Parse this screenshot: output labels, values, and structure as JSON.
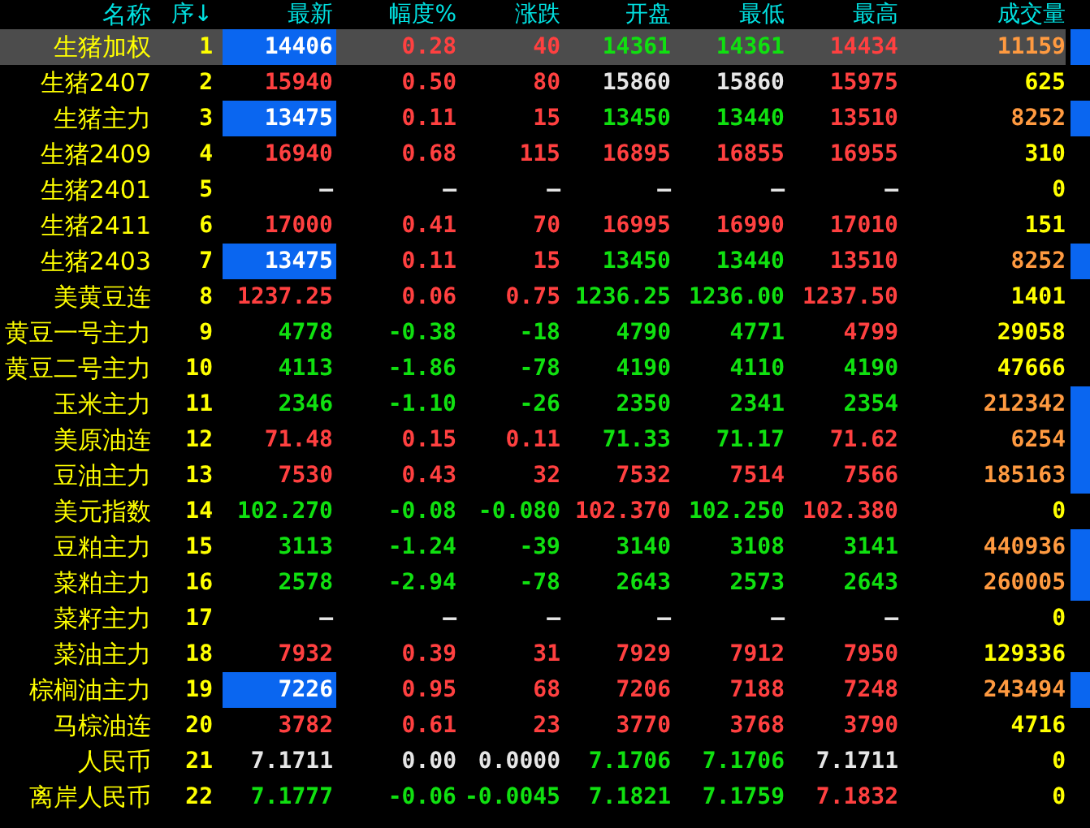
{
  "table": {
    "columns": [
      "名称",
      "序↓",
      "最新",
      "幅度%",
      "涨跌",
      "开盘",
      "最低",
      "最高",
      "成交量"
    ],
    "rows": [
      {
        "selected": true,
        "highlighted": true,
        "flagged": true,
        "cells": [
          {
            "text": "生猪加权",
            "color": "#ffff00"
          },
          {
            "text": "1",
            "color": "#ffff00"
          },
          {
            "text": "14406",
            "color": "#ffffff"
          },
          {
            "text": "0.28",
            "color": "#ff4040"
          },
          {
            "text": "40",
            "color": "#ff4040"
          },
          {
            "text": "14361",
            "color": "#10e010"
          },
          {
            "text": "14361",
            "color": "#10e010"
          },
          {
            "text": "14434",
            "color": "#ff4040"
          },
          {
            "text": "11159",
            "color": "#ff9a40"
          }
        ]
      },
      {
        "selected": false,
        "highlighted": false,
        "flagged": false,
        "cells": [
          {
            "text": "生猪2407",
            "color": "#ffff00"
          },
          {
            "text": "2",
            "color": "#ffff00"
          },
          {
            "text": "15940",
            "color": "#ff4040"
          },
          {
            "text": "0.50",
            "color": "#ff4040"
          },
          {
            "text": "80",
            "color": "#ff4040"
          },
          {
            "text": "15860",
            "color": "#e6e6e6"
          },
          {
            "text": "15860",
            "color": "#e6e6e6"
          },
          {
            "text": "15975",
            "color": "#ff4040"
          },
          {
            "text": "625",
            "color": "#ffff00"
          }
        ]
      },
      {
        "selected": false,
        "highlighted": true,
        "flagged": true,
        "cells": [
          {
            "text": "生猪主力",
            "color": "#ffff00"
          },
          {
            "text": "3",
            "color": "#ffff00"
          },
          {
            "text": "13475",
            "color": "#ffffff"
          },
          {
            "text": "0.11",
            "color": "#ff4040"
          },
          {
            "text": "15",
            "color": "#ff4040"
          },
          {
            "text": "13450",
            "color": "#10e010"
          },
          {
            "text": "13440",
            "color": "#10e010"
          },
          {
            "text": "13510",
            "color": "#ff4040"
          },
          {
            "text": "8252",
            "color": "#ff9a40"
          }
        ]
      },
      {
        "selected": false,
        "highlighted": false,
        "flagged": false,
        "cells": [
          {
            "text": "生猪2409",
            "color": "#ffff00"
          },
          {
            "text": "4",
            "color": "#ffff00"
          },
          {
            "text": "16940",
            "color": "#ff4040"
          },
          {
            "text": "0.68",
            "color": "#ff4040"
          },
          {
            "text": "115",
            "color": "#ff4040"
          },
          {
            "text": "16895",
            "color": "#ff4040"
          },
          {
            "text": "16855",
            "color": "#ff4040"
          },
          {
            "text": "16955",
            "color": "#ff4040"
          },
          {
            "text": "310",
            "color": "#ffff00"
          }
        ]
      },
      {
        "selected": false,
        "highlighted": false,
        "flagged": false,
        "cells": [
          {
            "text": "生猪2401",
            "color": "#ffff00"
          },
          {
            "text": "5",
            "color": "#ffff00"
          },
          {
            "text": "—",
            "color": "#e6e6e6"
          },
          {
            "text": "—",
            "color": "#e6e6e6"
          },
          {
            "text": "—",
            "color": "#e6e6e6"
          },
          {
            "text": "—",
            "color": "#e6e6e6"
          },
          {
            "text": "—",
            "color": "#e6e6e6"
          },
          {
            "text": "—",
            "color": "#e6e6e6"
          },
          {
            "text": "0",
            "color": "#ffff00"
          }
        ]
      },
      {
        "selected": false,
        "highlighted": false,
        "flagged": false,
        "cells": [
          {
            "text": "生猪2411",
            "color": "#ffff00"
          },
          {
            "text": "6",
            "color": "#ffff00"
          },
          {
            "text": "17000",
            "color": "#ff4040"
          },
          {
            "text": "0.41",
            "color": "#ff4040"
          },
          {
            "text": "70",
            "color": "#ff4040"
          },
          {
            "text": "16995",
            "color": "#ff4040"
          },
          {
            "text": "16990",
            "color": "#ff4040"
          },
          {
            "text": "17010",
            "color": "#ff4040"
          },
          {
            "text": "151",
            "color": "#ffff00"
          }
        ]
      },
      {
        "selected": false,
        "highlighted": true,
        "flagged": true,
        "cells": [
          {
            "text": "生猪2403",
            "color": "#ffff00"
          },
          {
            "text": "7",
            "color": "#ffff00"
          },
          {
            "text": "13475",
            "color": "#ffffff"
          },
          {
            "text": "0.11",
            "color": "#ff4040"
          },
          {
            "text": "15",
            "color": "#ff4040"
          },
          {
            "text": "13450",
            "color": "#10e010"
          },
          {
            "text": "13440",
            "color": "#10e010"
          },
          {
            "text": "13510",
            "color": "#ff4040"
          },
          {
            "text": "8252",
            "color": "#ff9a40"
          }
        ]
      },
      {
        "selected": false,
        "highlighted": false,
        "flagged": false,
        "cells": [
          {
            "text": "美黄豆连",
            "color": "#ffff00"
          },
          {
            "text": "8",
            "color": "#ffff00"
          },
          {
            "text": "1237.25",
            "color": "#ff4040"
          },
          {
            "text": "0.06",
            "color": "#ff4040"
          },
          {
            "text": "0.75",
            "color": "#ff4040"
          },
          {
            "text": "1236.25",
            "color": "#10e010"
          },
          {
            "text": "1236.00",
            "color": "#10e010"
          },
          {
            "text": "1237.50",
            "color": "#ff4040"
          },
          {
            "text": "1401",
            "color": "#ffff00"
          }
        ]
      },
      {
        "selected": false,
        "highlighted": false,
        "flagged": false,
        "cells": [
          {
            "text": "黄豆一号主力",
            "color": "#ffff00"
          },
          {
            "text": "9",
            "color": "#ffff00"
          },
          {
            "text": "4778",
            "color": "#10e010"
          },
          {
            "text": "-0.38",
            "color": "#10e010"
          },
          {
            "text": "-18",
            "color": "#10e010"
          },
          {
            "text": "4790",
            "color": "#10e010"
          },
          {
            "text": "4771",
            "color": "#10e010"
          },
          {
            "text": "4799",
            "color": "#ff4040"
          },
          {
            "text": "29058",
            "color": "#ffff00"
          }
        ]
      },
      {
        "selected": false,
        "highlighted": false,
        "flagged": false,
        "cells": [
          {
            "text": "黄豆二号主力",
            "color": "#ffff00"
          },
          {
            "text": "10",
            "color": "#ffff00"
          },
          {
            "text": "4113",
            "color": "#10e010"
          },
          {
            "text": "-1.86",
            "color": "#10e010"
          },
          {
            "text": "-78",
            "color": "#10e010"
          },
          {
            "text": "4190",
            "color": "#10e010"
          },
          {
            "text": "4110",
            "color": "#10e010"
          },
          {
            "text": "4190",
            "color": "#10e010"
          },
          {
            "text": "47666",
            "color": "#ffff00"
          }
        ]
      },
      {
        "selected": false,
        "highlighted": false,
        "flagged": true,
        "cells": [
          {
            "text": "玉米主力",
            "color": "#ffff00"
          },
          {
            "text": "11",
            "color": "#ffff00"
          },
          {
            "text": "2346",
            "color": "#10e010"
          },
          {
            "text": "-1.10",
            "color": "#10e010"
          },
          {
            "text": "-26",
            "color": "#10e010"
          },
          {
            "text": "2350",
            "color": "#10e010"
          },
          {
            "text": "2341",
            "color": "#10e010"
          },
          {
            "text": "2354",
            "color": "#10e010"
          },
          {
            "text": "212342",
            "color": "#ff9a40"
          }
        ]
      },
      {
        "selected": false,
        "highlighted": false,
        "flagged": true,
        "cells": [
          {
            "text": "美原油连",
            "color": "#ffff00"
          },
          {
            "text": "12",
            "color": "#ffff00"
          },
          {
            "text": "71.48",
            "color": "#ff4040"
          },
          {
            "text": "0.15",
            "color": "#ff4040"
          },
          {
            "text": "0.11",
            "color": "#ff4040"
          },
          {
            "text": "71.33",
            "color": "#10e010"
          },
          {
            "text": "71.17",
            "color": "#10e010"
          },
          {
            "text": "71.62",
            "color": "#ff4040"
          },
          {
            "text": "6254",
            "color": "#ff9a40"
          }
        ]
      },
      {
        "selected": false,
        "highlighted": false,
        "flagged": true,
        "cells": [
          {
            "text": "豆油主力",
            "color": "#ffff00"
          },
          {
            "text": "13",
            "color": "#ffff00"
          },
          {
            "text": "7530",
            "color": "#ff4040"
          },
          {
            "text": "0.43",
            "color": "#ff4040"
          },
          {
            "text": "32",
            "color": "#ff4040"
          },
          {
            "text": "7532",
            "color": "#ff4040"
          },
          {
            "text": "7514",
            "color": "#ff4040"
          },
          {
            "text": "7566",
            "color": "#ff4040"
          },
          {
            "text": "185163",
            "color": "#ff9a40"
          }
        ]
      },
      {
        "selected": false,
        "highlighted": false,
        "flagged": false,
        "cells": [
          {
            "text": "美元指数",
            "color": "#ffff00"
          },
          {
            "text": "14",
            "color": "#ffff00"
          },
          {
            "text": "102.270",
            "color": "#10e010"
          },
          {
            "text": "-0.08",
            "color": "#10e010"
          },
          {
            "text": "-0.080",
            "color": "#10e010"
          },
          {
            "text": "102.370",
            "color": "#ff4040"
          },
          {
            "text": "102.250",
            "color": "#10e010"
          },
          {
            "text": "102.380",
            "color": "#ff4040"
          },
          {
            "text": "0",
            "color": "#ffff00"
          }
        ]
      },
      {
        "selected": false,
        "highlighted": false,
        "flagged": true,
        "cells": [
          {
            "text": "豆粕主力",
            "color": "#ffff00"
          },
          {
            "text": "15",
            "color": "#ffff00"
          },
          {
            "text": "3113",
            "color": "#10e010"
          },
          {
            "text": "-1.24",
            "color": "#10e010"
          },
          {
            "text": "-39",
            "color": "#10e010"
          },
          {
            "text": "3140",
            "color": "#10e010"
          },
          {
            "text": "3108",
            "color": "#10e010"
          },
          {
            "text": "3141",
            "color": "#10e010"
          },
          {
            "text": "440936",
            "color": "#ff9a40"
          }
        ]
      },
      {
        "selected": false,
        "highlighted": false,
        "flagged": true,
        "cells": [
          {
            "text": "菜粕主力",
            "color": "#ffff00"
          },
          {
            "text": "16",
            "color": "#ffff00"
          },
          {
            "text": "2578",
            "color": "#10e010"
          },
          {
            "text": "-2.94",
            "color": "#10e010"
          },
          {
            "text": "-78",
            "color": "#10e010"
          },
          {
            "text": "2643",
            "color": "#10e010"
          },
          {
            "text": "2573",
            "color": "#10e010"
          },
          {
            "text": "2643",
            "color": "#10e010"
          },
          {
            "text": "260005",
            "color": "#ff9a40"
          }
        ]
      },
      {
        "selected": false,
        "highlighted": false,
        "flagged": false,
        "cells": [
          {
            "text": "菜籽主力",
            "color": "#ffff00"
          },
          {
            "text": "17",
            "color": "#ffff00"
          },
          {
            "text": "—",
            "color": "#e6e6e6"
          },
          {
            "text": "—",
            "color": "#e6e6e6"
          },
          {
            "text": "—",
            "color": "#e6e6e6"
          },
          {
            "text": "—",
            "color": "#e6e6e6"
          },
          {
            "text": "—",
            "color": "#e6e6e6"
          },
          {
            "text": "—",
            "color": "#e6e6e6"
          },
          {
            "text": "0",
            "color": "#ffff00"
          }
        ]
      },
      {
        "selected": false,
        "highlighted": false,
        "flagged": false,
        "cells": [
          {
            "text": "菜油主力",
            "color": "#ffff00"
          },
          {
            "text": "18",
            "color": "#ffff00"
          },
          {
            "text": "7932",
            "color": "#ff4040"
          },
          {
            "text": "0.39",
            "color": "#ff4040"
          },
          {
            "text": "31",
            "color": "#ff4040"
          },
          {
            "text": "7929",
            "color": "#ff4040"
          },
          {
            "text": "7912",
            "color": "#ff4040"
          },
          {
            "text": "7950",
            "color": "#ff4040"
          },
          {
            "text": "129336",
            "color": "#ffff00"
          }
        ]
      },
      {
        "selected": false,
        "highlighted": true,
        "flagged": true,
        "cells": [
          {
            "text": "棕榈油主力",
            "color": "#ffff00"
          },
          {
            "text": "19",
            "color": "#ffff00"
          },
          {
            "text": "7226",
            "color": "#ffffff"
          },
          {
            "text": "0.95",
            "color": "#ff4040"
          },
          {
            "text": "68",
            "color": "#ff4040"
          },
          {
            "text": "7206",
            "color": "#ff4040"
          },
          {
            "text": "7188",
            "color": "#ff4040"
          },
          {
            "text": "7248",
            "color": "#ff4040"
          },
          {
            "text": "243494",
            "color": "#ff9a40"
          }
        ]
      },
      {
        "selected": false,
        "highlighted": false,
        "flagged": false,
        "cells": [
          {
            "text": "马棕油连",
            "color": "#ffff00"
          },
          {
            "text": "20",
            "color": "#ffff00"
          },
          {
            "text": "3782",
            "color": "#ff4040"
          },
          {
            "text": "0.61",
            "color": "#ff4040"
          },
          {
            "text": "23",
            "color": "#ff4040"
          },
          {
            "text": "3770",
            "color": "#ff4040"
          },
          {
            "text": "3768",
            "color": "#ff4040"
          },
          {
            "text": "3790",
            "color": "#ff4040"
          },
          {
            "text": "4716",
            "color": "#ffff00"
          }
        ]
      },
      {
        "selected": false,
        "highlighted": false,
        "flagged": false,
        "cells": [
          {
            "text": "人民币",
            "color": "#ffff00"
          },
          {
            "text": "21",
            "color": "#ffff00"
          },
          {
            "text": "7.1711",
            "color": "#e6e6e6"
          },
          {
            "text": "0.00",
            "color": "#e6e6e6"
          },
          {
            "text": "0.0000",
            "color": "#e6e6e6"
          },
          {
            "text": "7.1706",
            "color": "#10e010"
          },
          {
            "text": "7.1706",
            "color": "#10e010"
          },
          {
            "text": "7.1711",
            "color": "#e6e6e6"
          },
          {
            "text": "0",
            "color": "#ffff00"
          }
        ]
      },
      {
        "selected": false,
        "highlighted": false,
        "flagged": false,
        "cells": [
          {
            "text": "离岸人民币",
            "color": "#ffff00"
          },
          {
            "text": "22",
            "color": "#ffff00"
          },
          {
            "text": "7.1777",
            "color": "#10e010"
          },
          {
            "text": "-0.06",
            "color": "#10e010"
          },
          {
            "text": "-0.0045",
            "color": "#10e010"
          },
          {
            "text": "7.1821",
            "color": "#10e010"
          },
          {
            "text": "7.1759",
            "color": "#10e010"
          },
          {
            "text": "7.1832",
            "color": "#ff4040"
          },
          {
            "text": "0",
            "color": "#ffff00"
          }
        ]
      }
    ]
  }
}
